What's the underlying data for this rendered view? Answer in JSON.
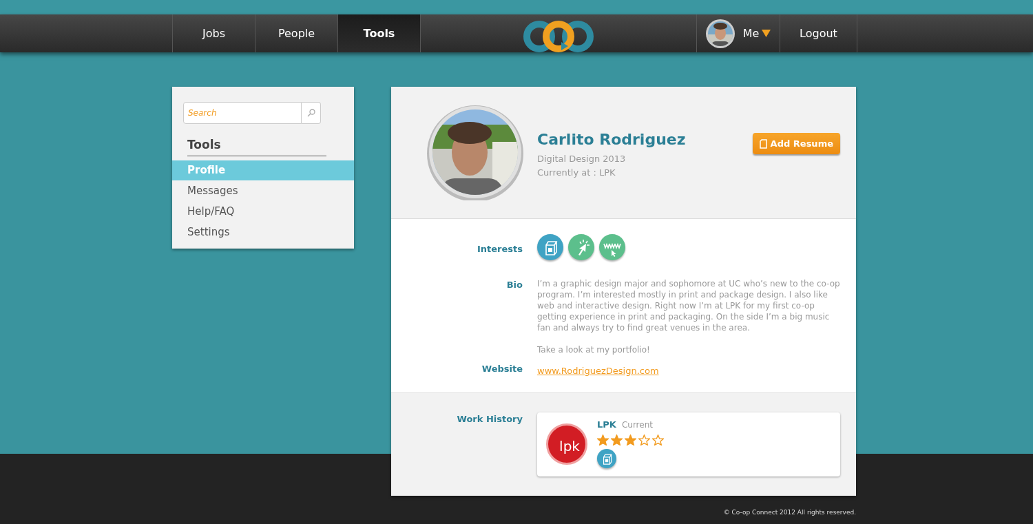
{
  "nav": {
    "items": [
      {
        "label": "Jobs",
        "selected": false
      },
      {
        "label": "People",
        "selected": false
      },
      {
        "label": "Tools",
        "selected": true
      }
    ],
    "user": {
      "label": "Me"
    },
    "logout": "Logout"
  },
  "sidebar": {
    "search": {
      "placeholder": "Search"
    },
    "heading": "Tools",
    "items": [
      {
        "label": "Profile",
        "selected": true
      },
      {
        "label": "Messages",
        "selected": false
      },
      {
        "label": "Help/FAQ",
        "selected": false
      },
      {
        "label": "Settings",
        "selected": false
      }
    ]
  },
  "profile": {
    "name": "Carlito Rodriguez",
    "program": "Digital Design 2013",
    "current": "Currently at : LPK",
    "add_resume": "Add Resume",
    "interests_label": "Interests",
    "interests": [
      {
        "kind": "package",
        "color": "#3fa3c4"
      },
      {
        "kind": "click",
        "color": "#5cbf8c"
      },
      {
        "kind": "web",
        "color": "#5cbf8c"
      }
    ],
    "bio_label": "Bio",
    "bio": [
      "I’m a graphic design major and sophomore at UC who’s new to the co-op program. I’m interested mostly in print and package design. I also like web and interactive design. Right now I’m at LPK for my first co-op getting experience in print and packaging. On the side I’m a big music fan and always try to find great venues in the area.",
      "Take a look at my portfolio!"
    ],
    "website_label": "Website",
    "website": "www.RodriguezDesign.com",
    "work_label": "Work History",
    "work": [
      {
        "logo": "lpk",
        "company": "LPK",
        "status": "Current",
        "stars": 3,
        "interests": [
          {
            "kind": "package",
            "color": "#3fa3c4"
          }
        ]
      }
    ]
  },
  "footer": "© Co-op Connect 2012 All rights reserved."
}
